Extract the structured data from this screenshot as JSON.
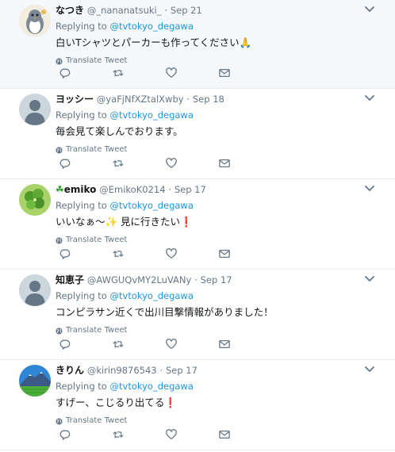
{
  "tweets": [
    {
      "name": "なつき",
      "handle": "@_nananatsuki_",
      "dot": "·",
      "date": "Sep 21",
      "replying_label": "Replying to",
      "replying_to": "@tvtokyo_degawa",
      "text": "白いTシャツとパーカーも作ってください🙏",
      "translate": "Translate Tweet",
      "avatar_icon": "penguin-avatar",
      "highlight": true
    },
    {
      "name": "ヨッシー",
      "handle": "@yaFjNfXZtalXwby",
      "dot": "·",
      "date": "Sep 18",
      "replying_label": "Replying to",
      "replying_to": "@tvtokyo_degawa",
      "text": "毎会見て楽しんでおります。",
      "translate": "Translate Tweet",
      "avatar_icon": "default-avatar"
    },
    {
      "name_prefix": "☘",
      "name": "emiko",
      "handle": "@EmikoK0214",
      "dot": "·",
      "date": "Sep 17",
      "replying_label": "Replying to",
      "replying_to": "@tvtokyo_degawa",
      "text": "いいなぁ～✨ 見に行きたい❗",
      "translate": "Translate Tweet",
      "avatar_icon": "clover-avatar"
    },
    {
      "name": "知恵子",
      "handle": "@AWGUQvMY2LuVANy",
      "dot": "·",
      "date": "Sep 17",
      "replying_label": "Replying to",
      "replying_to": "@tvtokyo_degawa",
      "text": "コンピラサン近くで出川目撃情報がありました！",
      "translate": "Translate Tweet",
      "avatar_icon": "default-avatar"
    },
    {
      "name": "きりん",
      "handle": "@kirin9876543",
      "dot": "·",
      "date": "Sep 17",
      "replying_label": "Replying to",
      "replying_to": "@tvtokyo_degawa",
      "text": "すげー、こじるり出てる❗",
      "translate": "Translate Tweet",
      "avatar_icon": "mountain-avatar"
    }
  ],
  "colors": {
    "accent": "#1b95e0",
    "muted": "#657786",
    "border": "#e6ecf0",
    "highlight_bg": "#f5f8fa"
  },
  "icons": {
    "reply": "reply-icon",
    "retweet": "retweet-icon",
    "like": "heart-icon",
    "dm": "envelope-icon",
    "translate": "globe-icon",
    "more": "chevron-down-icon"
  }
}
